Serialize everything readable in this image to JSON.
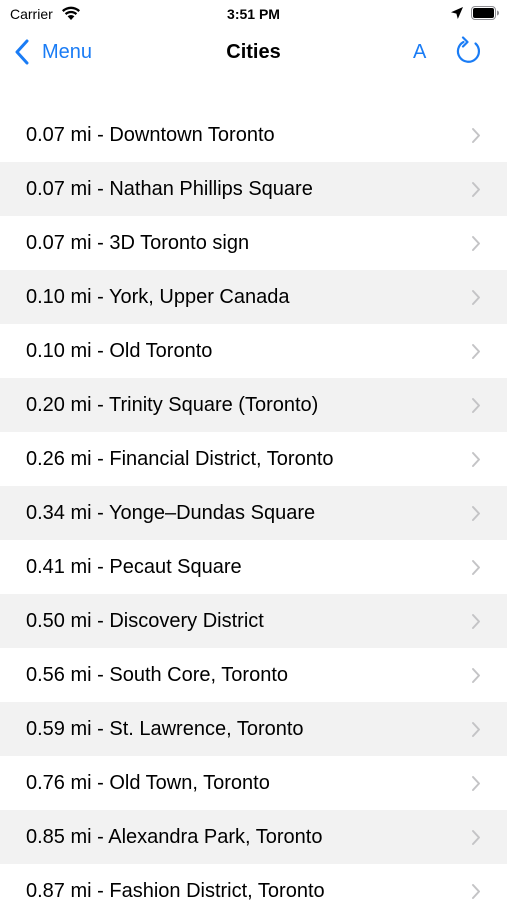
{
  "status_bar": {
    "carrier": "Carrier",
    "time": "3:51 PM",
    "icons": [
      "wifi-icon",
      "location-icon",
      "battery-icon"
    ]
  },
  "nav_bar": {
    "back_label": "Menu",
    "title": "Cities",
    "font_button_label": "A",
    "refresh_icon": "refresh-icon",
    "accent_color": "#1a7cf5"
  },
  "colors": {
    "alt_row_background": "#f2f2f2",
    "chevron": "#c4c4c6"
  },
  "cities": [
    {
      "label": "0.07 mi - Downtown Toronto"
    },
    {
      "label": "0.07 mi - Nathan Phillips Square"
    },
    {
      "label": "0.07 mi - 3D Toronto sign"
    },
    {
      "label": "0.10 mi - York, Upper Canada"
    },
    {
      "label": "0.10 mi - Old Toronto"
    },
    {
      "label": "0.20 mi - Trinity Square (Toronto)"
    },
    {
      "label": "0.26 mi - Financial District, Toronto"
    },
    {
      "label": "0.34 mi - Yonge–Dundas Square"
    },
    {
      "label": "0.41 mi - Pecaut Square"
    },
    {
      "label": "0.50 mi - Discovery District"
    },
    {
      "label": "0.56 mi - South Core, Toronto"
    },
    {
      "label": "0.59 mi - St. Lawrence, Toronto"
    },
    {
      "label": "0.76 mi - Old Town, Toronto"
    },
    {
      "label": "0.85 mi - Alexandra Park, Toronto"
    },
    {
      "label": "0.87 mi - Fashion District, Toronto"
    }
  ]
}
